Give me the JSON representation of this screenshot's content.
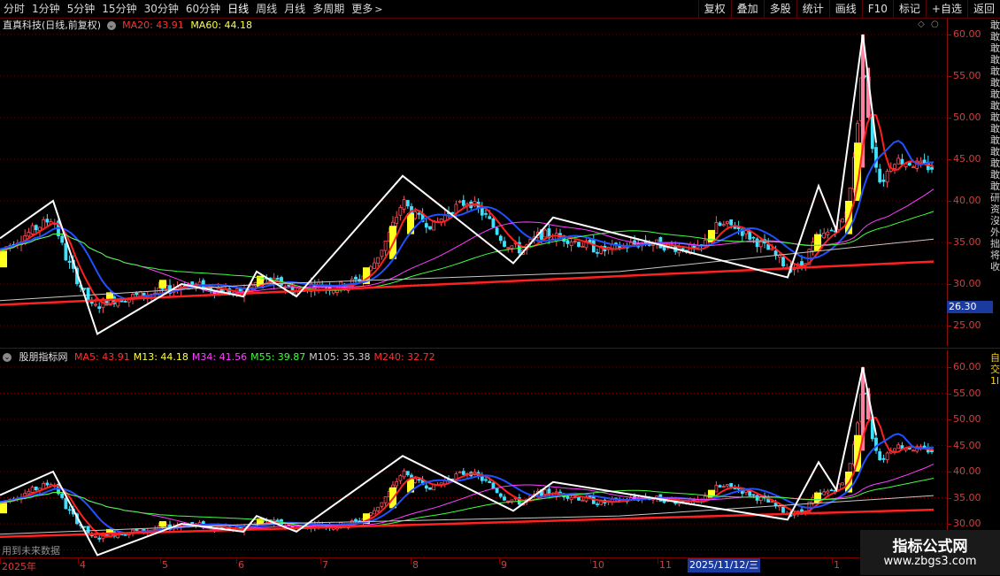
{
  "toolbar": {
    "periods": [
      "分时",
      "1分钟",
      "5分钟",
      "15分钟",
      "30分钟",
      "60分钟",
      "日线",
      "周线",
      "月线",
      "多周期",
      "更多"
    ],
    "active_period": "日线",
    "buttons": [
      "复权",
      "叠加",
      "多股",
      "统计",
      "画线",
      "F10",
      "标记",
      "+自选",
      "返回"
    ]
  },
  "main_panel": {
    "stock_title": "直真科技(日线,前复权)",
    "ma20_label": "MA20: 43.91",
    "ma60_label": "MA60: 44.18",
    "ma20_color": "#ff3030",
    "ma60_color": "#ffff40",
    "y_ticks": [
      "60.00",
      "55.00",
      "50.00",
      "45.00",
      "40.00",
      "35.00",
      "30.00",
      "25.00"
    ],
    "price_marker": "26.30",
    "side_glyphs": "敢敢敢敢敢敢敢敢敢敢敢敢敢敢敢研资沒外拙将收"
  },
  "indicator_panel": {
    "name": "股朋指标网",
    "labels": [
      {
        "text": "MA5: 43.91",
        "color": "#ff3030"
      },
      {
        "text": "M13: 44.18",
        "color": "#ffff40"
      },
      {
        "text": "M34: 41.56",
        "color": "#ff40ff"
      },
      {
        "text": "M55: 39.87",
        "color": "#40ff40"
      },
      {
        "text": "M105: 35.38",
        "color": "#d0d0d0"
      },
      {
        "text": "M240: 32.72",
        "color": "#ff3030"
      }
    ],
    "y_ticks": [
      "60.00",
      "55.00",
      "50.00",
      "45.00",
      "40.00",
      "35.00",
      "30.00"
    ],
    "side_glyphs": "自交1l1l1l1l1l",
    "future_note": "用到未来数据"
  },
  "date_axis": {
    "labels": [
      "2025年",
      "4",
      "5",
      "6",
      "7",
      "8",
      "9",
      "10",
      "11",
      "1"
    ],
    "cursor_label": "2025/11/12/三"
  },
  "watermark": {
    "title": "指标公式网",
    "url": "www.zbgs3.com"
  },
  "chart_data": {
    "type": "line",
    "title": "",
    "xlabel": "",
    "ylabel": "",
    "ylim": [
      22,
      61
    ],
    "x": [
      "2025年",
      "4",
      "5",
      "6",
      "7",
      "8",
      "9",
      "10",
      "11",
      "2025/11/12",
      "1"
    ],
    "series": [
      {
        "name": "MA5",
        "values": [
          35,
          28,
          30,
          30,
          30,
          40,
          38,
          36,
          34,
          33,
          44
        ]
      },
      {
        "name": "M13",
        "values": [
          34,
          29,
          30,
          30,
          30,
          38,
          38,
          35,
          34,
          33,
          44
        ]
      },
      {
        "name": "M34",
        "values": [
          33,
          31,
          29,
          29,
          30,
          33,
          36,
          35,
          34,
          33,
          41.5
        ]
      },
      {
        "name": "M55",
        "values": [
          31,
          32,
          30,
          29,
          29,
          31,
          34,
          35,
          34,
          34,
          39.9
        ]
      },
      {
        "name": "M105",
        "values": [
          28,
          29,
          30,
          30,
          30,
          30,
          31,
          32,
          33,
          33,
          35.4
        ]
      },
      {
        "name": "M240",
        "values": [
          27.5,
          28,
          28.5,
          29,
          29.3,
          29.7,
          30.1,
          30.6,
          31.1,
          31.5,
          32.7
        ]
      }
    ]
  }
}
